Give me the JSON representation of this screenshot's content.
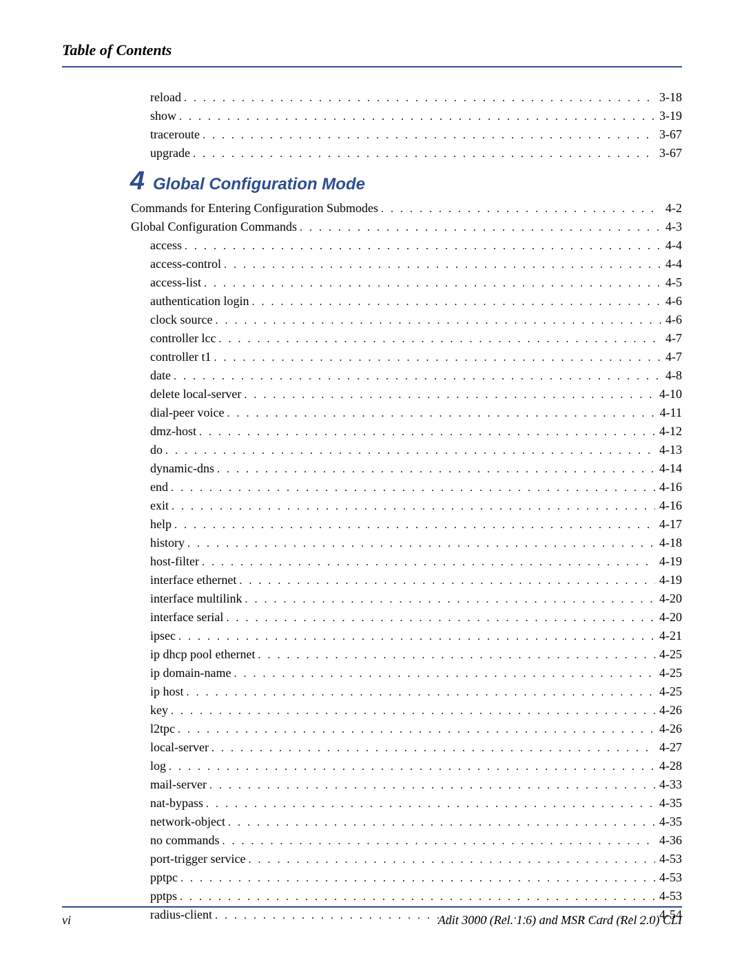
{
  "header": {
    "title": "Table of Contents"
  },
  "pre": [
    {
      "label": "reload",
      "page": "3-18"
    },
    {
      "label": "show",
      "page": "3-19"
    },
    {
      "label": "traceroute",
      "page": "3-67"
    },
    {
      "label": "upgrade",
      "page": "3-67"
    }
  ],
  "chapter": {
    "number": "4",
    "title": "Global Configuration Mode"
  },
  "top_entries": [
    {
      "label": "Commands for Entering Configuration Submodes",
      "page": "4-2"
    },
    {
      "label": "Global Configuration Commands",
      "page": "4-3"
    }
  ],
  "sub_entries": [
    {
      "label": "access",
      "page": "4-4"
    },
    {
      "label": "access-control",
      "page": "4-4"
    },
    {
      "label": "access-list",
      "page": "4-5"
    },
    {
      "label": "authentication login",
      "page": "4-6"
    },
    {
      "label": "clock source",
      "page": "4-6"
    },
    {
      "label": "controller lcc",
      "page": "4-7"
    },
    {
      "label": "controller t1",
      "page": "4-7"
    },
    {
      "label": "date",
      "page": "4-8"
    },
    {
      "label": "delete local-server",
      "page": "4-10"
    },
    {
      "label": "dial-peer voice",
      "page": "4-11"
    },
    {
      "label": "dmz-host",
      "page": "4-12"
    },
    {
      "label": "do",
      "page": "4-13"
    },
    {
      "label": "dynamic-dns",
      "page": "4-14"
    },
    {
      "label": "end",
      "page": "4-16"
    },
    {
      "label": "exit",
      "page": "4-16"
    },
    {
      "label": "help",
      "page": "4-17"
    },
    {
      "label": "history",
      "page": "4-18"
    },
    {
      "label": "host-filter",
      "page": "4-19"
    },
    {
      "label": "interface ethernet",
      "page": "4-19"
    },
    {
      "label": "interface multilink",
      "page": "4-20"
    },
    {
      "label": "interface serial",
      "page": "4-20"
    },
    {
      "label": "ipsec",
      "page": "4-21"
    },
    {
      "label": "ip dhcp pool ethernet",
      "page": "4-25"
    },
    {
      "label": "ip domain-name",
      "page": "4-25"
    },
    {
      "label": "ip host",
      "page": "4-25"
    },
    {
      "label": "key",
      "page": "4-26"
    },
    {
      "label": "l2tpc",
      "page": "4-26"
    },
    {
      "label": "local-server",
      "page": "4-27"
    },
    {
      "label": "log",
      "page": "4-28"
    },
    {
      "label": "mail-server",
      "page": "4-33"
    },
    {
      "label": "nat-bypass",
      "page": "4-35"
    },
    {
      "label": "network-object",
      "page": "4-35"
    },
    {
      "label": "no commands",
      "page": "4-36"
    },
    {
      "label": "port-trigger service",
      "page": "4-53"
    },
    {
      "label": "pptpc",
      "page": "4-53"
    },
    {
      "label": "pptps",
      "page": "4-53"
    },
    {
      "label": "radius-client",
      "page": "4-54"
    }
  ],
  "footer": {
    "pagenum": "vi",
    "doc": "Adit 3000 (Rel. 1.6) and MSR Card (Rel 2.0) CLI"
  }
}
